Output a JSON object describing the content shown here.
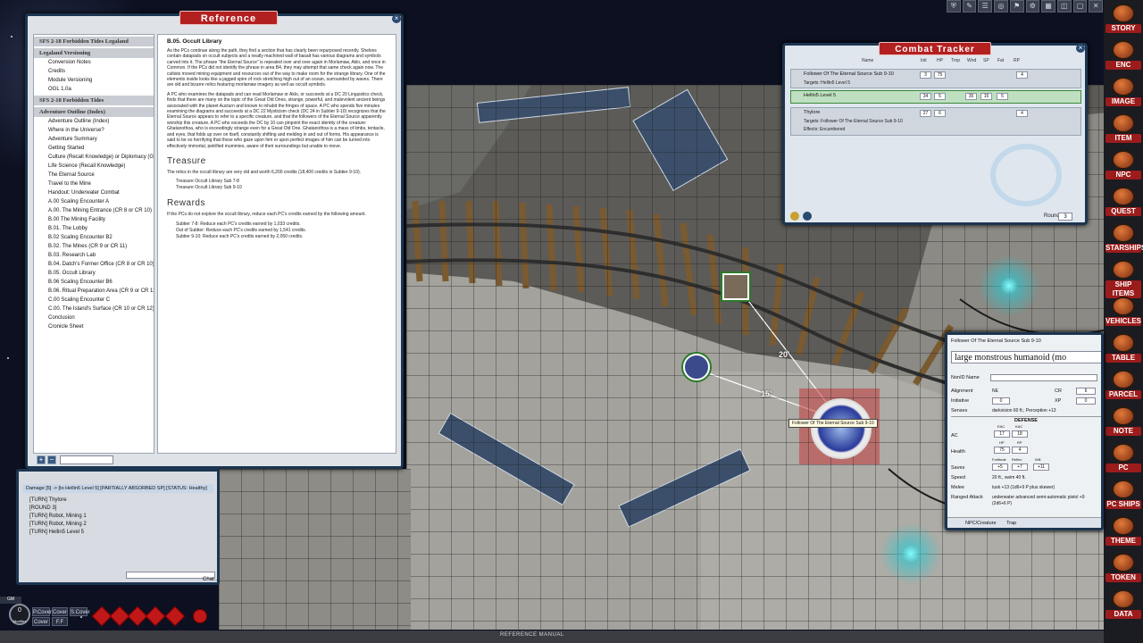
{
  "reference": {
    "title": "Reference",
    "nav_groups": [
      {
        "header": "SFS 2-18 Forbidden Tides Legaland",
        "items": []
      },
      {
        "header": "Legaland Versioning",
        "items": [
          "Conversion Notes",
          "Credits",
          "Module Versioning",
          "OGL 1.0a"
        ]
      },
      {
        "header": "SFS 2-18 Forbidden Tides",
        "items": []
      },
      {
        "header": "Adventure Outline (Index)",
        "items": [
          "Adventure Outline (Index)",
          "Where in the Universe?",
          "Adventure Summary",
          "Getting Started",
          "Culture (Recall Knowledge) or Diplomacy (Gat",
          "Life Science (Recall Knowledge)",
          "The Eternal Source",
          "Travel to the Mine",
          "Handout: Underwater Combat",
          "A.00 Scaling Encounter A",
          "A.00. The Mining Entrance (CR 8 or CR 10)",
          "B.00 The Mining Facility",
          "B.01. The Lobby",
          "B.02 Scaling Encounter B2",
          "B.02. The Mines (CR 9 or CR 11)",
          "B.03. Research Lab",
          "B.04. Datch's Former Office (CR 8 or CR 10)",
          "B.05. Occult Library",
          "B.06 Scaling Encounter B6",
          "B.06. Ritual Preparation Area (CR 9 or CR 11)",
          "C.00 Scaling Encounter C",
          "C.00. The Island's Surface (CR 10 or CR 12)",
          "Conclusion",
          "Cronicle Sheet"
        ]
      }
    ],
    "section_title": "B.05. Occult Library",
    "paragraphs": [
      "As the PCs continue along the path, they find a section that has clearly been repurposed recently. Shelves contain datapads on occult subjects and a neatly machined wall of basalt has various diagrams and symbols carved into it. The phrase \"the Eternal Source\" is repeated over and over again in Morlamaw, Aklo, and once in Common. If the PCs did not identify the phrase in area B4, they may attempt that same check again now. The cultists moved mining equipment and resources out of the way to make room for the strange library. One of the elements inside looks like a jagged spire of rock stretching high out of an ocean, surrounded by waves. There are old and bizarre relics featuring morlamaw imagery as well as occult symbols.",
      "A PC who examines the datapads and can read Morlamaw or Aklo, or succeeds at a DC 20 Linguistics check, finds that there are many on the topic of the Great Old Ones, strange, powerful, and malevolent ancient beings associated with the planet Aucturn and known to inhabit the fringes of space. A PC who spends five minutes examining the diagrams and succeeds at a DC 22 Mysticism check (DC 24 in Subtier 9-10) recognizes that the Eternal Source appears to refer to a specific creature, and that the followers of the Eternal Source apparently worship this creature. A PC who exceeds the DC by 10 can pinpoint the exact identity of the creature: Ghatanothoa, who is exceedingly strange even for a Great Old One. Ghatanothoa is a mass of limbs, tentacle, and eyes, that folds up over on itself, constantly shifting and melding in and out of forms. His appearance is said to be so horrifying that those who gaze upon him or upon perfect images of him can be turned into effectively immortal, petrified mummies, aware of their surroundings but unable to move."
    ],
    "treasure_heading": "Treasure",
    "treasure_text": "The relics in the occult library are very old and worth 6,200 credits (18,400 credits in Subtier 9-10).",
    "treasure_links": [
      "Treasure Occult Library Sub 7-8",
      "Treasure Occult Library Sub 9-10"
    ],
    "rewards_heading": "Rewards",
    "rewards_text": "If the PCs do not explore the occult library, reduce each PC's credits earned by the following amount.",
    "rewards_lines": [
      "Subtier 7-8: Reduce each PC's credits earned by 1,033 credits.",
      "Out of Subtier: Reduce each PC's credits earned by 1,541 credits.",
      "Subtier 9-10: Reduce each PC's credits earned by 2,050 credits."
    ]
  },
  "chat": {
    "damage_line": "Damage [5] -> [to Hellin5 Level 5] [PARTIALLY ABSORBED SP] [STATUS: Healthy]",
    "messages": [
      "[TURN] Thylore",
      "[ROUND 3]",
      "[TURN] Robot, Mining 1",
      "[TURN] Robot, Mining 2",
      "[TURN] Hellin5 Level 5"
    ],
    "input_label": "Chat..."
  },
  "hotbar": {
    "keys": [
      "P.Cover",
      "Cover",
      "S.Cover",
      "Cover",
      "F.F"
    ],
    "mod_label": "GM",
    "mod_value": "0",
    "mod_sub": "Modifier",
    "dice": [
      "d4",
      "d6",
      "d8",
      "d10",
      "d12",
      "d20",
      "d%"
    ]
  },
  "bottom_strip_label": "REFERENCE MANUAL",
  "toolbar": {
    "buttons": [
      "⛨",
      "✎",
      "☰",
      "◎",
      "⚑",
      "⚙",
      "▦",
      "◫",
      "▢",
      "✕"
    ]
  },
  "sidebar": {
    "items": [
      "STORY",
      "ENC",
      "IMAGE",
      "ITEM",
      "NPC",
      "QUEST",
      "STARSHIPS",
      "SHIP ITEMS",
      "VEHICLES",
      "TABLE",
      "PARCEL",
      "NOTE",
      "PC",
      "PC SHIPS",
      "THEME",
      "TOKEN",
      "DATA"
    ]
  },
  "combat_tracker": {
    "title": "Combat Tracker",
    "columns": [
      "Name",
      "Init",
      "HP",
      "Tmp",
      "Wnd",
      "SP",
      "Fat",
      "RP"
    ],
    "rows": [
      {
        "name": "Follower Of The Eternal Source Sub 9-10",
        "init": "3",
        "hp": "75",
        "wnd": "4",
        "targets": "Targets: Hellin5 Level 5",
        "active": false
      },
      {
        "name": "Hellin5 Level 5",
        "init": "34",
        "hp": "5",
        "tmp": "35",
        "wnd": "15",
        "sp": "5",
        "active": true
      },
      {
        "name": "Thylore",
        "init": "27",
        "hp": "6",
        "wnd": "4",
        "targets": "Targets: Follower Of The Eternal Source Sub 9-10",
        "effects": "Effects: Encumbered",
        "active": false
      }
    ],
    "round_label": "Round",
    "round": "3"
  },
  "map": {
    "range_labels": [
      "20'",
      "15'"
    ],
    "enemy_tooltip": "Follower Of The Eternal Source Sub 9-10"
  },
  "npc_sheet": {
    "name": "Follower Of The Eternal Source Sub 9-10",
    "type": "large monstrous humanoid (mo",
    "fields": {
      "nonid_label": "NonID Name",
      "alignment_label": "Alignment",
      "alignment": "NE",
      "cr_label": "CR",
      "cr": "6",
      "initiative_label": "Initiative",
      "initiative": "0",
      "xp_label": "XP",
      "xp": "0",
      "senses_label": "Senses",
      "senses": "darkvision 60 ft.; Perception +13",
      "defense_label": "DEFENSE",
      "ac_label": "AC",
      "eac_label": "EAC",
      "kac_label": "KAC",
      "eac": "17",
      "kac": "18",
      "health_label": "Health",
      "hp_label": "HP",
      "rp_label": "RP",
      "hp": "75",
      "rp": "4",
      "saves_label": "Saves",
      "fort_label": "Fortitude",
      "ref_label": "Reflex",
      "will_label": "Will",
      "fort": "+5",
      "ref": "+7",
      "will": "+11",
      "speed_label": "Speed",
      "speed": "20 ft., swim 40 ft.",
      "melee_label": "Melee",
      "melee": "tusk +13 (1d6+9 P plus skewer)",
      "ranged_label": "Ranged Attack",
      "ranged": "underwater advanced semi-automatic pistol +9 (2d6+6 P)"
    },
    "tabs": [
      "NPC/Creature",
      "Trap"
    ]
  },
  "colors": {
    "accent_red": "#b32020",
    "frame_blue": "#1c3550",
    "active_row": "#bfe0c0"
  }
}
